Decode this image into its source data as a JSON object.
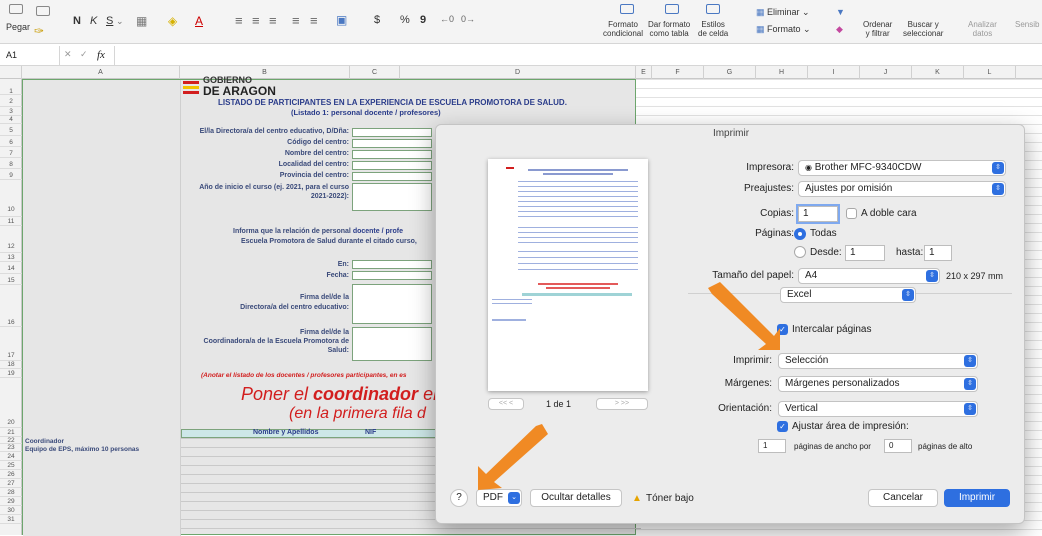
{
  "ribbon": {
    "paste": "Pegar",
    "bold": "N",
    "italic": "K",
    "underline": "S",
    "currency": "$",
    "percent": "%",
    "thousands": "9",
    "cond_format": [
      "Formato",
      "condicional"
    ],
    "table_format": [
      "Dar formato",
      "como tabla"
    ],
    "cell_styles": [
      "Estilos",
      "de celda"
    ],
    "delete": "Eliminar",
    "format": "Formato",
    "sort_filter": [
      "Ordenar",
      "y filtrar"
    ],
    "find_select": [
      "Buscar y",
      "seleccionar"
    ],
    "analyze": [
      "Analizar",
      "datos"
    ],
    "sensitivity": "Sensib"
  },
  "formula_bar": {
    "cell_ref": "A1",
    "fx": "fx"
  },
  "columns": [
    "A",
    "B",
    "C",
    "D",
    "E",
    "F",
    "G",
    "H",
    "I",
    "J",
    "K",
    "L"
  ],
  "rows": [
    "1",
    "2",
    "3",
    "4",
    "5",
    "6",
    "7",
    "8",
    "9",
    "10",
    "11",
    "12",
    "13",
    "14",
    "15",
    "16",
    "17",
    "18",
    "19",
    "20",
    "21",
    "22",
    "23",
    "24",
    "25",
    "26",
    "27",
    "28",
    "29",
    "30",
    "31"
  ],
  "sheet": {
    "logo_top": "GOBIERNO",
    "logo": "DE ARAGON",
    "title": "LISTADO DE PARTICIPANTES EN LA EXPERIENCIA DE ESCUELA PROMOTORA DE SALUD.",
    "subtitle": "(Listado 1: personal docente / profesores)",
    "labels": {
      "director": "El/la Directora/a del centro educativo, D/Dña:",
      "code": "Código del centro:",
      "name": "Nombre del centro:",
      "locality": "Localidad del centro:",
      "province": "Provincia del centro:",
      "year1": "Año de inicio el curso (ej. 2021, para el curso",
      "year2": "2021-2022):",
      "inform1": "Informa que la relación de personal ",
      "inform1b": "docente / profe",
      "inform2": "Escuela Promotora de Salud durante el citado curso,",
      "en": "En:",
      "fecha": "Fecha:",
      "sig1a": "Firma del/de la",
      "sig1b": "Directora/a del centro educativo:",
      "sig2a": "Firma del/de la",
      "sig2b": "Coordinadora/a de la Escuela Promotora de",
      "sig2c": "Salud:",
      "note": "(Anotar el listado de los docentes / profesores participantes, en es",
      "big1a": "Poner el ",
      "big1b": "coordinador",
      "big1c": " el",
      "big2": "(en la primera fila d",
      "th_name": "Nombre y Apellidos",
      "th_nif": "NIF",
      "coord": "Coordinador",
      "team": "Equipo de EPS, máximo 10 personas"
    }
  },
  "dialog": {
    "title": "Imprimir",
    "printer_label": "Impresora:",
    "printer": "Brother MFC-9340CDW",
    "presets_label": "Preajustes:",
    "presets": "Ajustes por omisión",
    "copies_label": "Copias:",
    "copies": "1",
    "duplex": "A doble cara",
    "pages_label": "Páginas:",
    "pages_all": "Todas",
    "pages_from": "Desde:",
    "from_val": "1",
    "pages_to": "hasta:",
    "to_val": "1",
    "paper_label": "Tamaño del papel:",
    "paper": "A4",
    "paper_dims": "210 x 297 mm",
    "app": "Excel",
    "collate": "Intercalar páginas",
    "print_label": "Imprimir:",
    "print_val": "Selección",
    "margins_label": "Márgenes:",
    "margins": "Márgenes personalizados",
    "orient_label": "Orientación:",
    "orient": "Vertical",
    "fit": "Ajustar área de impresión:",
    "fit_w": "1",
    "fit_w_label": "páginas de ancho por",
    "fit_h": "0",
    "fit_h_label": "páginas de alto",
    "page_counter": "1 de 1",
    "nav_first": "<<",
    "nav_prev": "<",
    "nav_next": ">",
    "nav_last": ">>",
    "help": "?",
    "pdf": "PDF",
    "hide_details": "Ocultar detalles",
    "low_toner": "Tóner bajo",
    "cancel": "Cancelar",
    "print": "Imprimir"
  },
  "colors": {
    "accent": "#2e6fe0",
    "arrow": "#f08a24",
    "sheet_text": "#3a4a7a",
    "red": "#d21e1e"
  }
}
